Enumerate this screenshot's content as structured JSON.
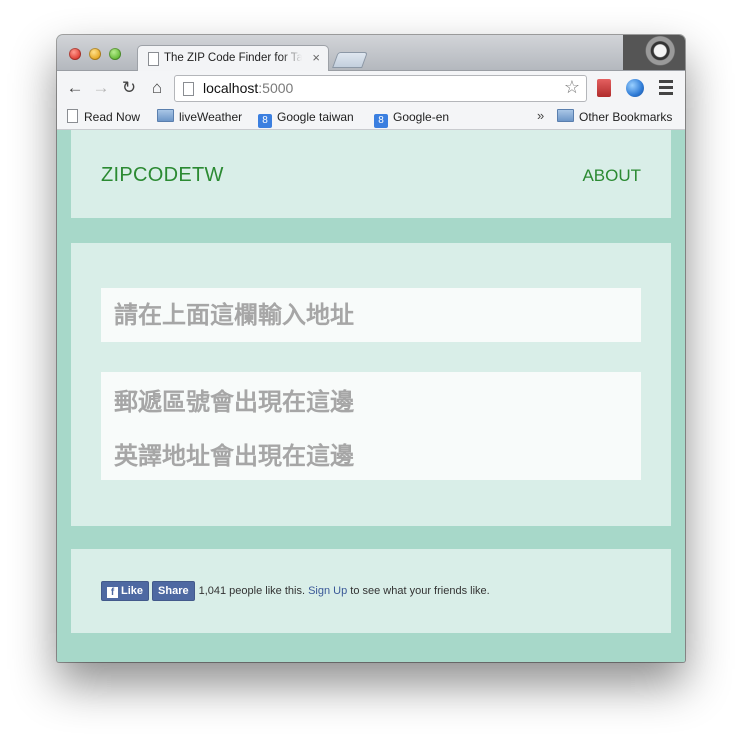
{
  "browser": {
    "tab_title": "The ZIP Code Finder for Taiwan",
    "tab_close": "×",
    "url_host": "localhost",
    "url_port": ":5000",
    "nav": {
      "back": "←",
      "forward": "→",
      "reload": "↻",
      "home": "⌂",
      "star": "☆"
    }
  },
  "bookmarks": {
    "items": [
      {
        "label": "Read Now",
        "icon": "page-icon"
      },
      {
        "label": "liveWeather",
        "icon": "folder-icon"
      },
      {
        "label": "Google taiwan",
        "icon": "google-icon"
      },
      {
        "label": "Google-en",
        "icon": "google-icon"
      }
    ],
    "more": "»",
    "other": "Other Bookmarks",
    "google_glyph": "8"
  },
  "site": {
    "brand": "ZIPCODETW",
    "about": "ABOUT",
    "input_placeholder": "請在上面這欄輸入地址",
    "result_zip": "郵遞區號會出現在這邊",
    "result_address": "英譯地址會出現在這邊"
  },
  "facebook": {
    "like_label": "Like",
    "share_label": "Share",
    "f_glyph": "f",
    "text_pre": "1,041 people like this.",
    "signup": "Sign Up",
    "text_post": "to see what your friends like."
  },
  "colors": {
    "brand_green": "#2b8a32",
    "page_bg": "#a7d8c9",
    "panel_bg": "#d9eee8",
    "facebook_blue": "#4e69a2"
  }
}
